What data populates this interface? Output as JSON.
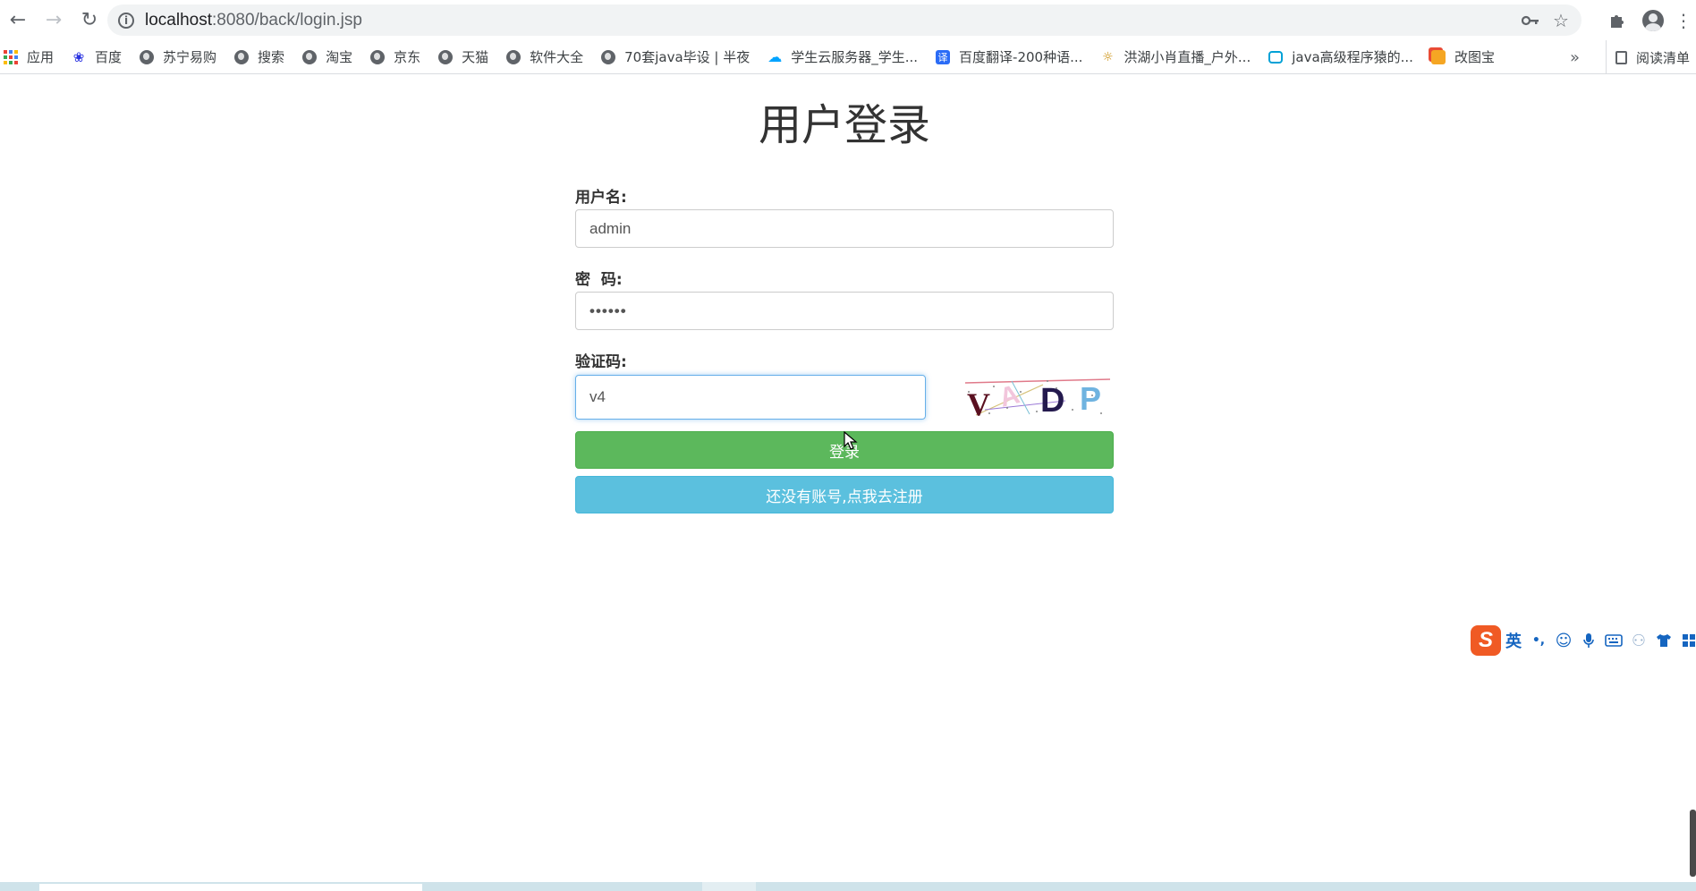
{
  "browser": {
    "url_host": "localhost",
    "url_path": ":8080/back/login.jsp",
    "bookmarks": [
      {
        "label": "应用",
        "icon": "apps-grid-icon"
      },
      {
        "label": "百度",
        "icon": "baidu-paw-icon"
      },
      {
        "label": "苏宁易购",
        "icon": "globe-icon"
      },
      {
        "label": "搜索",
        "icon": "globe-icon"
      },
      {
        "label": "淘宝",
        "icon": "globe-icon"
      },
      {
        "label": "京东",
        "icon": "globe-icon"
      },
      {
        "label": "天猫",
        "icon": "globe-icon"
      },
      {
        "label": "软件大全",
        "icon": "globe-icon"
      },
      {
        "label": "70套java毕设 | 半夜",
        "icon": "globe-icon"
      },
      {
        "label": "学生云服务器_学生...",
        "icon": "cloud-icon"
      },
      {
        "label": "百度翻译-200种语...",
        "icon": "translate-icon"
      },
      {
        "label": "洪湖小肖直播_户外...",
        "icon": "live-icon"
      },
      {
        "label": "java高级程序猿的...",
        "icon": "bilibili-icon"
      },
      {
        "label": "改图宝",
        "icon": "image-edit-icon"
      }
    ],
    "more_label": "»",
    "reading_list_label": "阅读清单"
  },
  "page": {
    "title": "用户登录",
    "username_label": "用户名:",
    "username_value": "admin",
    "password_label": "密  码:",
    "password_value": "••••••",
    "captcha_label": "验证码:",
    "captcha_value": "v4",
    "captcha_text": "VADP",
    "login_button": "登录",
    "register_button": "还没有账号,点我去注册"
  },
  "ime": {
    "mode": "英",
    "punct": "•,"
  },
  "colors": {
    "login": "#5cb85c",
    "register": "#5bc0de",
    "focus": "#66afe9",
    "ime_logo": "#f05a24"
  }
}
